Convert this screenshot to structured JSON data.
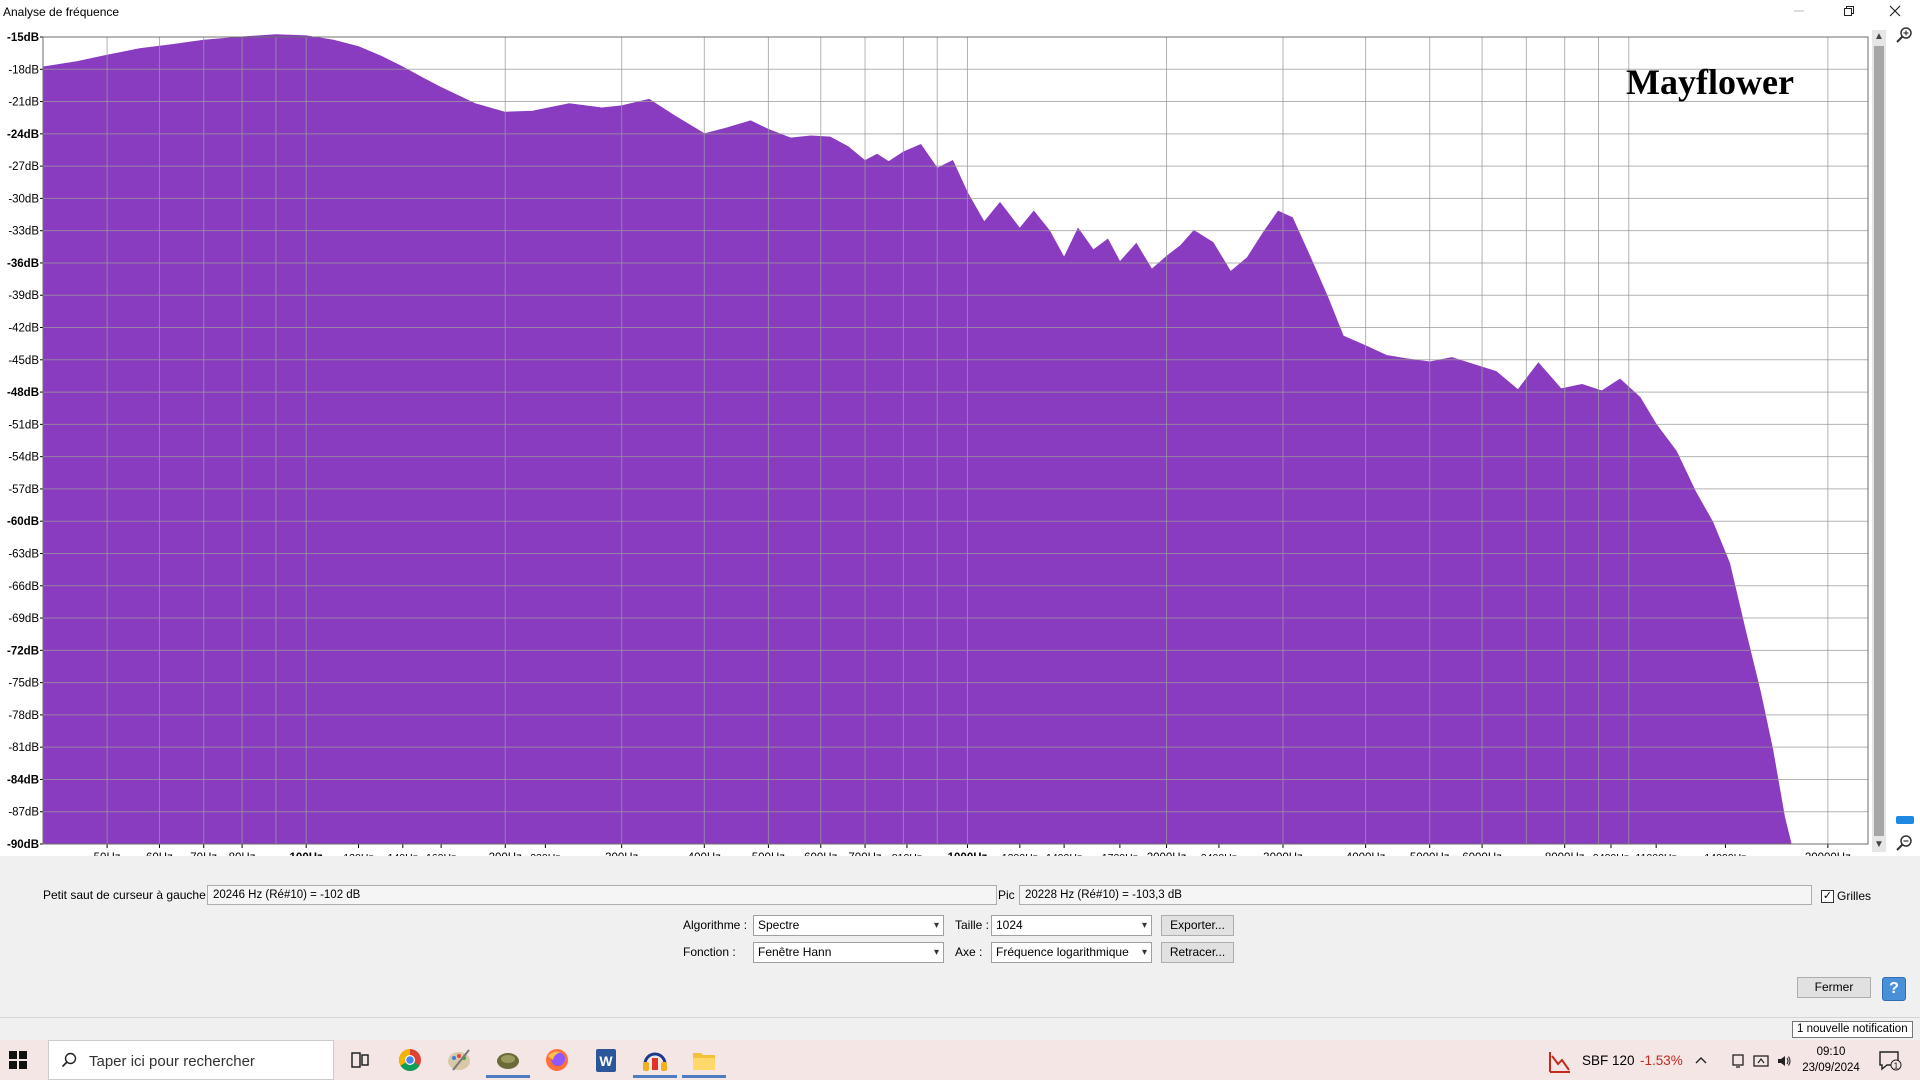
{
  "window": {
    "title": "Analyse de fréquence",
    "minimize_icon": "minimize-icon",
    "restore_icon": "restore-icon",
    "close_icon": "close-icon"
  },
  "chart_data": {
    "type": "area",
    "annotation": "Mayflower",
    "xscale": "log",
    "xlim": [
      40,
      23000
    ],
    "ylim": [
      -90,
      -15
    ],
    "grid": true,
    "color": "#8a3cc1",
    "yticks": [
      {
        "v": -15,
        "label": "-15dB",
        "bold": true
      },
      {
        "v": -18,
        "label": "-18dB",
        "bold": false
      },
      {
        "v": -21,
        "label": "-21dB",
        "bold": false
      },
      {
        "v": -24,
        "label": "-24dB",
        "bold": true
      },
      {
        "v": -27,
        "label": "-27dB",
        "bold": false
      },
      {
        "v": -30,
        "label": "-30dB",
        "bold": false
      },
      {
        "v": -33,
        "label": "-33dB",
        "bold": false
      },
      {
        "v": -36,
        "label": "-36dB",
        "bold": true
      },
      {
        "v": -39,
        "label": "-39dB",
        "bold": false
      },
      {
        "v": -42,
        "label": "-42dB",
        "bold": false
      },
      {
        "v": -45,
        "label": "-45dB",
        "bold": false
      },
      {
        "v": -48,
        "label": "-48dB",
        "bold": true
      },
      {
        "v": -51,
        "label": "-51dB",
        "bold": false
      },
      {
        "v": -54,
        "label": "-54dB",
        "bold": false
      },
      {
        "v": -57,
        "label": "-57dB",
        "bold": false
      },
      {
        "v": -60,
        "label": "-60dB",
        "bold": true
      },
      {
        "v": -63,
        "label": "-63dB",
        "bold": false
      },
      {
        "v": -66,
        "label": "-66dB",
        "bold": false
      },
      {
        "v": -69,
        "label": "-69dB",
        "bold": false
      },
      {
        "v": -72,
        "label": "-72dB",
        "bold": true
      },
      {
        "v": -75,
        "label": "-75dB",
        "bold": false
      },
      {
        "v": -78,
        "label": "-78dB",
        "bold": false
      },
      {
        "v": -81,
        "label": "-81dB",
        "bold": false
      },
      {
        "v": -84,
        "label": "-84dB",
        "bold": true
      },
      {
        "v": -87,
        "label": "-87dB",
        "bold": false
      },
      {
        "v": -90,
        "label": "-90dB",
        "bold": true
      }
    ],
    "xticks": [
      {
        "f": 50,
        "label": "50Hz"
      },
      {
        "f": 60,
        "label": "60Hz"
      },
      {
        "f": 70,
        "label": "70Hz"
      },
      {
        "f": 80,
        "label": "80Hz"
      },
      {
        "f": 100,
        "label": "100Hz",
        "bold": true
      },
      {
        "f": 120,
        "label": "120Hz",
        "small": true
      },
      {
        "f": 140,
        "label": "140Hz",
        "small": true
      },
      {
        "f": 160,
        "label": "160Hz",
        "small": true
      },
      {
        "f": 200,
        "label": "200Hz"
      },
      {
        "f": 230,
        "label": "230Hz",
        "small": true
      },
      {
        "f": 300,
        "label": "300Hz"
      },
      {
        "f": 400,
        "label": "400Hz"
      },
      {
        "f": 500,
        "label": "500Hz"
      },
      {
        "f": 600,
        "label": "600Hz"
      },
      {
        "f": 700,
        "label": "700Hz"
      },
      {
        "f": 810,
        "label": "810Hz",
        "small": true
      },
      {
        "f": 1000,
        "label": "1000Hz",
        "bold": true
      },
      {
        "f": 1200,
        "label": "1200Hz",
        "small": true
      },
      {
        "f": 1400,
        "label": "1400Hz",
        "small": true
      },
      {
        "f": 1700,
        "label": "1700Hz",
        "small": true
      },
      {
        "f": 2000,
        "label": "2000Hz"
      },
      {
        "f": 2400,
        "label": "2400Hz",
        "small": true
      },
      {
        "f": 3000,
        "label": "3000Hz"
      },
      {
        "f": 4000,
        "label": "4000Hz"
      },
      {
        "f": 5000,
        "label": "5000Hz"
      },
      {
        "f": 6000,
        "label": "6000Hz"
      },
      {
        "f": 8000,
        "label": "8000Hz"
      },
      {
        "f": 9400,
        "label": "9400Hz",
        "small": true
      },
      {
        "f": 11000,
        "label": "11000Hz",
        "small": true
      },
      {
        "f": 14000,
        "label": "14000Hz",
        "small": true
      },
      {
        "f": 20000,
        "label": "20000Hz"
      }
    ],
    "x": [
      40,
      45,
      50,
      56,
      63,
      70,
      80,
      90,
      100,
      110,
      120,
      130,
      140,
      150,
      160,
      180,
      200,
      220,
      250,
      280,
      300,
      330,
      360,
      400,
      430,
      470,
      500,
      540,
      580,
      620,
      660,
      700,
      730,
      760,
      800,
      850,
      900,
      950,
      1000,
      1060,
      1120,
      1200,
      1260,
      1330,
      1400,
      1470,
      1550,
      1630,
      1700,
      1800,
      1900,
      2000,
      2100,
      2200,
      2350,
      2500,
      2650,
      2800,
      2950,
      3100,
      3300,
      3500,
      3700,
      4000,
      4300,
      4600,
      5000,
      5400,
      5800,
      6300,
      6800,
      7300,
      7900,
      8500,
      9100,
      9700,
      10400,
      11000,
      11800,
      12600,
      13400,
      14200,
      15000,
      15800,
      16500,
      17200,
      17600,
      18000,
      18500
    ],
    "y": [
      -17.8,
      -17.3,
      -16.7,
      -16.1,
      -15.7,
      -15.3,
      -15.0,
      -14.8,
      -14.9,
      -15.3,
      -15.9,
      -16.8,
      -17.8,
      -18.8,
      -19.7,
      -21.2,
      -22.0,
      -21.9,
      -21.2,
      -21.6,
      -21.4,
      -20.8,
      -22.3,
      -24.0,
      -23.5,
      -22.8,
      -23.6,
      -24.4,
      -24.2,
      -24.3,
      -25.2,
      -26.5,
      -25.9,
      -26.6,
      -25.7,
      -25.0,
      -27.2,
      -26.5,
      -29.5,
      -32.2,
      -30.4,
      -32.8,
      -31.2,
      -33.0,
      -35.5,
      -32.8,
      -34.8,
      -33.8,
      -35.9,
      -34.2,
      -36.6,
      -35.4,
      -34.4,
      -33.0,
      -34.1,
      -36.8,
      -35.5,
      -33.2,
      -31.2,
      -31.8,
      -35.5,
      -39.1,
      -42.8,
      -43.7,
      -44.6,
      -44.9,
      -45.2,
      -44.8,
      -45.4,
      -46.1,
      -47.8,
      -45.3,
      -47.7,
      -47.3,
      -47.9,
      -46.8,
      -48.5,
      -51.0,
      -53.5,
      -57.2,
      -60.1,
      -63.9,
      -70.1,
      -75.8,
      -81.2,
      -87.5,
      -90.0,
      -90.0,
      -90.0
    ]
  },
  "controls": {
    "cursor_label": "Petit saut de curseur à gauche :",
    "cursor_value": "20246 Hz (Ré#10) = -102 dB",
    "peak_label": "Pic :",
    "peak_value": "20228 Hz (Ré#10) = -103,3 dB",
    "grid_checkbox_label": "Grilles",
    "grid_checked": true,
    "algorithm_label": "Algorithme :",
    "algorithm_value": "Spectre",
    "function_label": "Fonction :",
    "function_value": "Fenêtre Hann",
    "size_label": "Taille :",
    "size_value": "1024",
    "axis_label": "Axe :",
    "axis_value": "Fréquence logarithmique",
    "export_button": "Exporter...",
    "replot_button": "Retracer...",
    "close_button": "Fermer",
    "help_button": "?"
  },
  "notification": "1 nouvelle notification",
  "taskbar": {
    "search_placeholder": "Taper ici pour rechercher",
    "apps": [
      "task-view-icon",
      "chrome-icon",
      "paint-icon",
      "app-icon",
      "firefox-icon",
      "word-icon",
      "audacity-icon",
      "file-explorer-icon"
    ],
    "stock_name": "SBF 120",
    "stock_change": "-1.53%",
    "stock_color": "#c42b1c",
    "time": "09:10",
    "date": "23/09/2024"
  }
}
